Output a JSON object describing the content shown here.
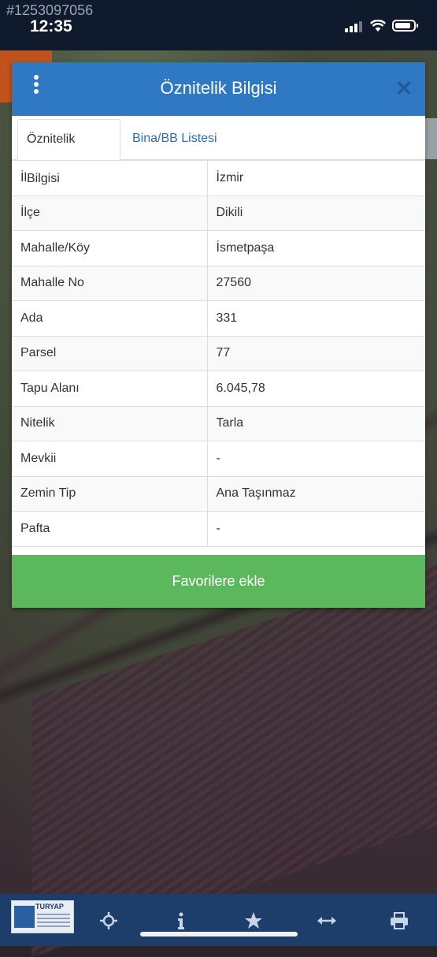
{
  "status_bar": {
    "listing_id": "#1253097056",
    "time": "12:35"
  },
  "dialog": {
    "title": "Öznitelik Bilgisi",
    "tabs": [
      {
        "label": "Öznitelik Bilgisi",
        "active": true
      },
      {
        "label": "Bina/BB Listesi",
        "active": false
      }
    ],
    "rows": [
      {
        "key": "İl",
        "value": "İzmir"
      },
      {
        "key": "İlçe",
        "value": "Dikili"
      },
      {
        "key": "Mahalle/Köy",
        "value": "İsmetpaşa"
      },
      {
        "key": "Mahalle No",
        "value": "27560"
      },
      {
        "key": "Ada",
        "value": "331"
      },
      {
        "key": "Parsel",
        "value": "77"
      },
      {
        "key": "Tapu Alanı",
        "value": "6.045,78"
      },
      {
        "key": "Nitelik",
        "value": "Tarla"
      },
      {
        "key": "Mevkii",
        "value": "-"
      },
      {
        "key": "Zemin Tip",
        "value": "Ana Taşınmaz"
      },
      {
        "key": "Pafta",
        "value": "-"
      }
    ],
    "favorite_button": "Favorilere ekle"
  },
  "toolbar": {
    "logo_text": "TURYAP",
    "icons": [
      "crosshair-icon",
      "info-icon",
      "star-icon",
      "arrows-horizontal-icon",
      "printer-icon"
    ]
  },
  "colors": {
    "header_blue": "#2f78c4",
    "favorite_green": "#5cb85c",
    "toolbar_navy": "#1d3d6b"
  }
}
